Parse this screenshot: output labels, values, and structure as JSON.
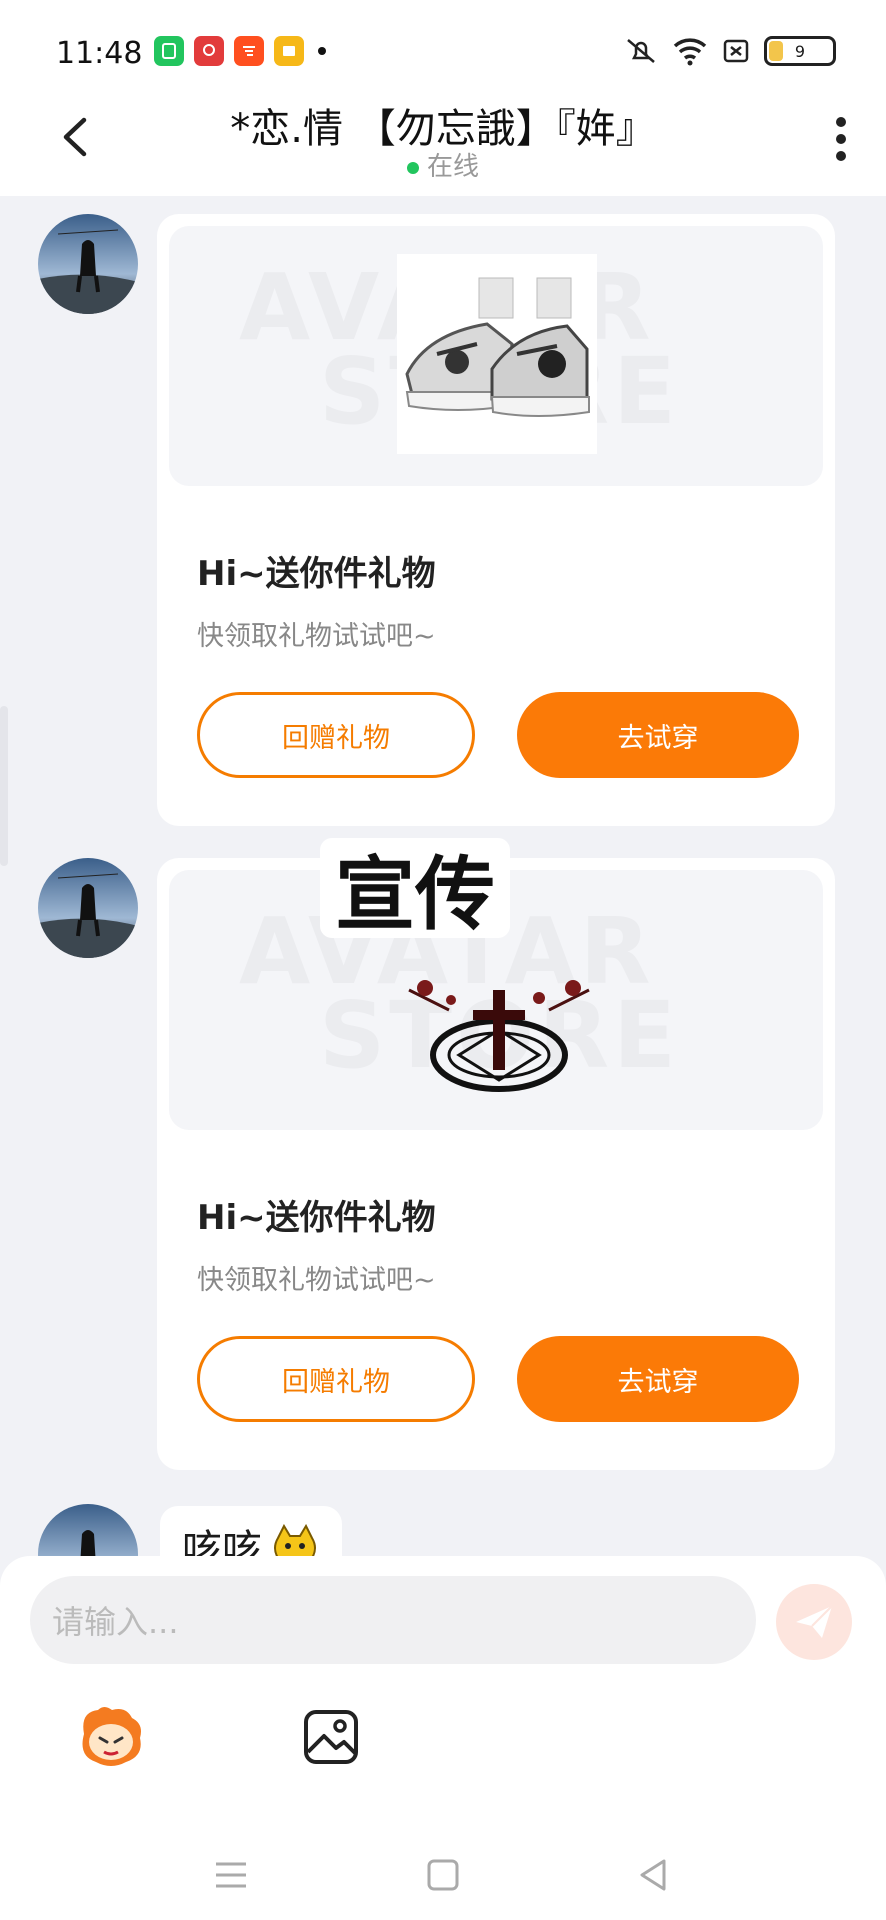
{
  "status_bar": {
    "time": "11:48",
    "battery": "9",
    "app_icons": [
      "app-green-icon",
      "pinduoduo-icon",
      "taobao-icon",
      "reader-icon"
    ],
    "system_icons": [
      "mute-icon",
      "wifi-icon",
      "sim-icon",
      "battery-icon"
    ]
  },
  "header": {
    "title": "*恋.情 【勿忘誐】『姩』",
    "status": "在线",
    "status_color": "#22c55e"
  },
  "messages": [
    {
      "type": "gift_card",
      "image_label": "sneaker-gift-image",
      "watermark_line1": "AVATAR",
      "watermark_line2": "STORE",
      "title": "Hi~送你件礼物",
      "subtitle": "快领取礼物试试吧~",
      "return_gift_label": "回赠礼物",
      "try_on_label": "去试穿"
    },
    {
      "type": "gift_card",
      "image_label": "cross-emblem-gift-image",
      "watermark_line1": "AVATAR",
      "watermark_line2": "STORE",
      "title": "Hi~送你件礼物",
      "subtitle": "快领取礼物试试吧~",
      "return_gift_label": "回赠礼物",
      "try_on_label": "去试穿"
    },
    {
      "type": "text",
      "text": "咳咳"
    }
  ],
  "overlay_caption": "宣传",
  "composer": {
    "placeholder": "请输入...",
    "tools": [
      "emoji-icon",
      "image-icon"
    ]
  },
  "colors": {
    "accent": "#fb7a07",
    "background": "#f1f2f6"
  }
}
